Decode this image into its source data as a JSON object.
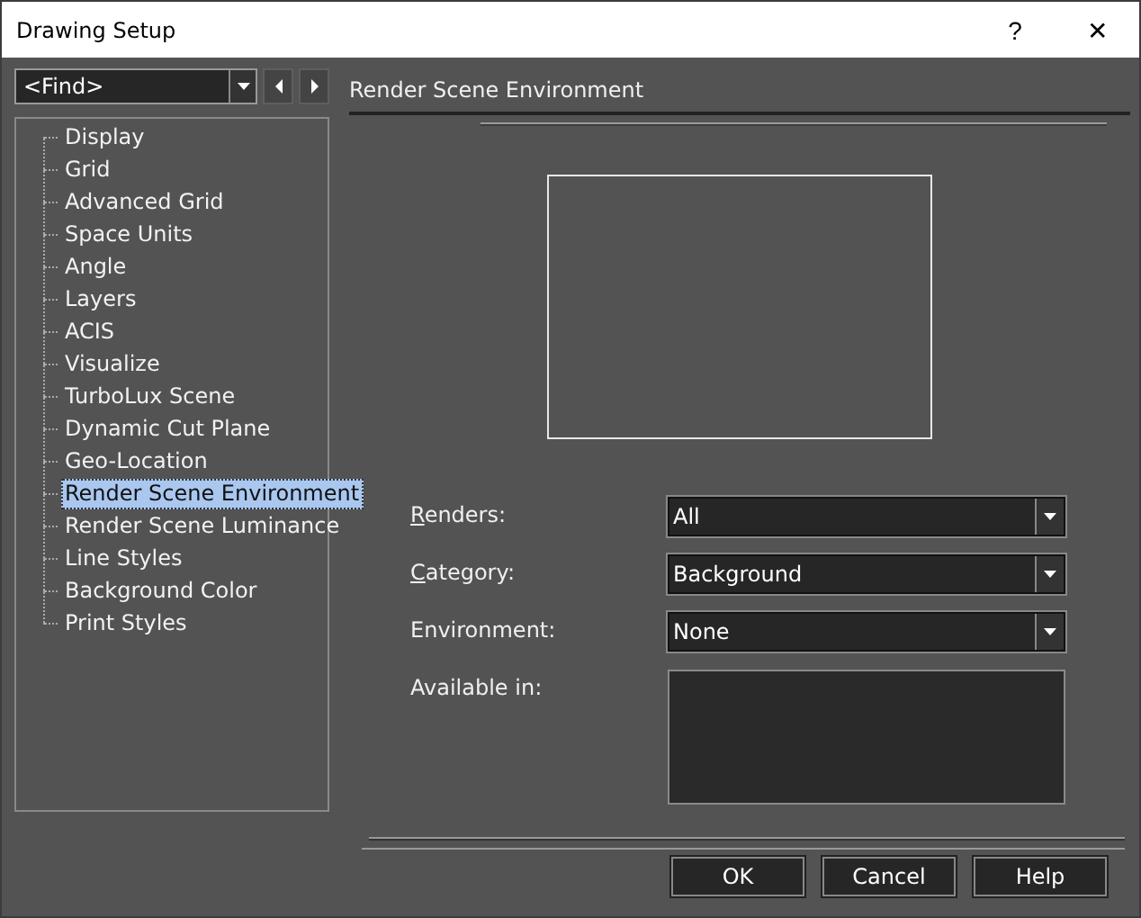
{
  "window": {
    "title": "Drawing Setup",
    "help_glyph": "?",
    "close_glyph": "✕"
  },
  "find": {
    "value": "<Find>"
  },
  "tree": {
    "items": [
      {
        "label": "Display",
        "selected": false
      },
      {
        "label": "Grid",
        "selected": false
      },
      {
        "label": "Advanced Grid",
        "selected": false
      },
      {
        "label": "Space Units",
        "selected": false
      },
      {
        "label": "Angle",
        "selected": false
      },
      {
        "label": "Layers",
        "selected": false
      },
      {
        "label": "ACIS",
        "selected": false
      },
      {
        "label": "Visualize",
        "selected": false
      },
      {
        "label": "TurboLux Scene",
        "selected": false
      },
      {
        "label": "Dynamic Cut Plane",
        "selected": false
      },
      {
        "label": "Geo-Location",
        "selected": false
      },
      {
        "label": "Render Scene Environment",
        "selected": true
      },
      {
        "label": "Render Scene Luminance",
        "selected": false
      },
      {
        "label": "Line Styles",
        "selected": false
      },
      {
        "label": "Background Color",
        "selected": false
      },
      {
        "label": "Print Styles",
        "selected": false
      }
    ]
  },
  "panel": {
    "title": "Render Scene Environment"
  },
  "fields": [
    {
      "kind": "combo",
      "label": "Renders:",
      "underline_first": true,
      "value": "All"
    },
    {
      "kind": "combo",
      "label": "Category:",
      "underline_first": true,
      "value": "Background"
    },
    {
      "kind": "combo",
      "label": "Environment:",
      "underline_first": false,
      "value": "None"
    },
    {
      "kind": "list",
      "label": "Available in:",
      "underline_first": false
    }
  ],
  "buttons": [
    "OK",
    "Cancel",
    "Help"
  ]
}
